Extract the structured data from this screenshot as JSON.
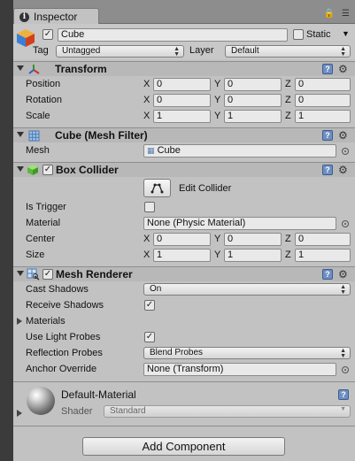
{
  "window": {
    "tab_title": "Inspector"
  },
  "header": {
    "object_name": "Cube",
    "static_label": "Static",
    "tag_label": "Tag",
    "tag_value": "Untagged",
    "layer_label": "Layer",
    "layer_value": "Default"
  },
  "transform": {
    "title": "Transform",
    "rows": [
      {
        "label": "Position",
        "x": "0",
        "y": "0",
        "z": "0"
      },
      {
        "label": "Rotation",
        "x": "0",
        "y": "0",
        "z": "0"
      },
      {
        "label": "Scale",
        "x": "1",
        "y": "1",
        "z": "1"
      }
    ],
    "axis": {
      "x": "X",
      "y": "Y",
      "z": "Z"
    }
  },
  "mesh_filter": {
    "title": "Cube (Mesh Filter)",
    "mesh_label": "Mesh",
    "mesh_value": "Cube"
  },
  "box_collider": {
    "title": "Box Collider",
    "edit_label": "Edit Collider",
    "is_trigger_label": "Is Trigger",
    "material_label": "Material",
    "material_value": "None (Physic Material)",
    "center_label": "Center",
    "center": {
      "x": "0",
      "y": "0",
      "z": "0"
    },
    "size_label": "Size",
    "size": {
      "x": "1",
      "y": "1",
      "z": "1"
    }
  },
  "mesh_renderer": {
    "title": "Mesh Renderer",
    "cast_shadows_label": "Cast Shadows",
    "cast_shadows_value": "On",
    "receive_shadows_label": "Receive Shadows",
    "materials_label": "Materials",
    "use_light_probes_label": "Use Light Probes",
    "reflection_probes_label": "Reflection Probes",
    "reflection_probes_value": "Blend Probes",
    "anchor_override_label": "Anchor Override",
    "anchor_override_value": "None (Transform)"
  },
  "material": {
    "name": "Default-Material",
    "shader_label": "Shader",
    "shader_value": "Standard"
  },
  "footer": {
    "add_component_label": "Add Component"
  },
  "icons": {
    "tab": "info-icon",
    "object": "cube-icon",
    "transform": "transform-axes-icon",
    "mesh_filter": "mesh-grid-icon",
    "box_collider": "green-cube-icon",
    "mesh_renderer": "mesh-renderer-icon",
    "help": "help-book-icon",
    "settings": "gear-icon",
    "picker": "object-picker-icon",
    "lock": "lock-icon",
    "menu": "menu-icon"
  }
}
